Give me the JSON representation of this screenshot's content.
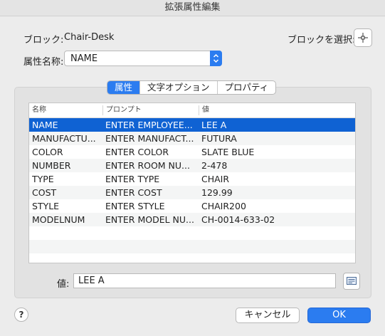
{
  "window": {
    "title": "拡張属性編集"
  },
  "block": {
    "label": "ブロック:",
    "name": "Chair-Desk",
    "select_label": "ブロックを選択:"
  },
  "tag": {
    "label": "属性名称:",
    "selected": "NAME"
  },
  "tabs": [
    {
      "label": "属性",
      "active": true
    },
    {
      "label": "文字オプション",
      "active": false
    },
    {
      "label": "プロパティ",
      "active": false
    }
  ],
  "table": {
    "columns": [
      "名称",
      "プロンプト",
      "値"
    ],
    "rows": [
      {
        "name": "NAME",
        "prompt": "ENTER EMPLOYEE...",
        "value": "LEE A",
        "selected": true
      },
      {
        "name": "MANUFACTU...",
        "prompt": "ENTER MANUFACT...",
        "value": "FUTURA"
      },
      {
        "name": "COLOR",
        "prompt": "ENTER COLOR",
        "value": "SLATE BLUE"
      },
      {
        "name": "NUMBER",
        "prompt": "ENTER ROOM NU...",
        "value": "2-478"
      },
      {
        "name": "TYPE",
        "prompt": "ENTER TYPE",
        "value": "CHAIR"
      },
      {
        "name": "COST",
        "prompt": "ENTER COST",
        "value": "129.99"
      },
      {
        "name": "STYLE",
        "prompt": "ENTER STYLE",
        "value": "CHAIR200"
      },
      {
        "name": "MODELNUM",
        "prompt": "ENTER MODEL NU...",
        "value": "CH-0014-633-02"
      }
    ]
  },
  "value_field": {
    "label": "値:",
    "value": "LEE A"
  },
  "buttons": {
    "help": "?",
    "cancel": "キャンセル",
    "ok": "OK"
  },
  "colors": {
    "accent": "#2b7cf0",
    "selection": "#0f62d3"
  }
}
